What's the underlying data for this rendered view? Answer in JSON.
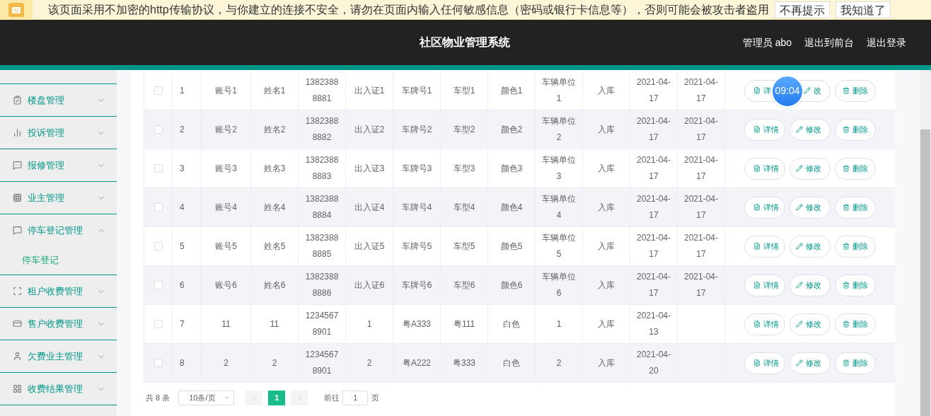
{
  "notice": {
    "text": "该页面采用不加密的http传输协议，与你建立的连接不安全，请勿在页面内输入任何敏感信息（密码或银行卡信息等），否则可能会被攻击者盗用",
    "buttons": [
      "不再提示",
      "我知道了"
    ]
  },
  "header": {
    "title": "社区物业管理系统",
    "links": [
      "管理员 abo",
      "退出到前台",
      "退出登录"
    ]
  },
  "sidebar": {
    "items": [
      {
        "label": "楼盘管理",
        "expanded": false
      },
      {
        "label": "投诉管理",
        "expanded": false
      },
      {
        "label": "报修管理",
        "expanded": false
      },
      {
        "label": "业主管理",
        "expanded": false
      },
      {
        "label": "停车登记管理",
        "expanded": true,
        "children": [
          {
            "label": "停车登记",
            "selected": true
          }
        ]
      },
      {
        "label": "租户收费管理",
        "expanded": false
      },
      {
        "label": "售户收费管理",
        "expanded": false
      },
      {
        "label": "欠费业主管理",
        "expanded": false
      },
      {
        "label": "收费结果管理",
        "expanded": false
      }
    ]
  },
  "table": {
    "rows": [
      {
        "checked": false,
        "cells": [
          "1",
          "账号1",
          "姓名1",
          "13823888881",
          "出入证1",
          "车牌号1",
          "车型1",
          "颜色1",
          "车辆单位1",
          "入库",
          "2021-04-17",
          "2021-04-17"
        ],
        "actions": [
          "详",
          "改",
          "删除"
        ]
      },
      {
        "checked": false,
        "cells": [
          "2",
          "账号2",
          "姓名2",
          "13823888882",
          "出入证2",
          "车牌号2",
          "车型2",
          "颜色2",
          "车辆单位2",
          "入库",
          "2021-04-17",
          "2021-04-17"
        ],
        "actions": [
          "详情",
          "修改",
          "删除"
        ]
      },
      {
        "checked": false,
        "cells": [
          "3",
          "账号3",
          "姓名3",
          "13823888883",
          "出入证3",
          "车牌号3",
          "车型3",
          "颜色3",
          "车辆单位3",
          "入库",
          "2021-04-17",
          "2021-04-17"
        ],
        "actions": [
          "详情",
          "修改",
          "删除"
        ]
      },
      {
        "checked": false,
        "cells": [
          "4",
          "账号4",
          "姓名4",
          "13823888884",
          "出入证4",
          "车牌号4",
          "车型4",
          "颜色4",
          "车辆单位4",
          "入库",
          "2021-04-17",
          "2021-04-17"
        ],
        "actions": [
          "详情",
          "修改",
          "删除"
        ]
      },
      {
        "checked": false,
        "cells": [
          "5",
          "账号5",
          "姓名5",
          "13823888885",
          "出入证5",
          "车牌号5",
          "车型5",
          "颜色5",
          "车辆单位5",
          "入库",
          "2021-04-17",
          "2021-04-17"
        ],
        "actions": [
          "详情",
          "修改",
          "删除"
        ]
      },
      {
        "checked": false,
        "cells": [
          "6",
          "账号6",
          "姓名6",
          "13823888886",
          "出入证6",
          "车牌号6",
          "车型6",
          "颜色6",
          "车辆单位6",
          "入库",
          "2021-04-17",
          "2021-04-17"
        ],
        "actions": [
          "详情",
          "修改",
          "删除"
        ]
      },
      {
        "checked": false,
        "cells": [
          "7",
          "11",
          "11",
          "12345678901",
          "1",
          "粤A333",
          "粤111",
          "白色",
          "1",
          "入库",
          "2021-04-13",
          ""
        ],
        "actions": [
          "详情",
          "修改",
          "删除"
        ]
      },
      {
        "checked": false,
        "cells": [
          "8",
          "2",
          "2",
          "12345678901",
          "2",
          "粤A222",
          "粤333",
          "白色",
          "2",
          "入库",
          "2021-04-20",
          ""
        ],
        "actions": [
          "详情",
          "修改",
          "删除"
        ]
      }
    ]
  },
  "pagination": {
    "total": "共 8 条",
    "page_size": "10条/页",
    "pages": [
      {
        "label": "1",
        "selected": true
      }
    ],
    "goto_label": "前往",
    "goto_value": "1",
    "page_unit": "页"
  },
  "clock_widget": {
    "time": "09:04"
  }
}
